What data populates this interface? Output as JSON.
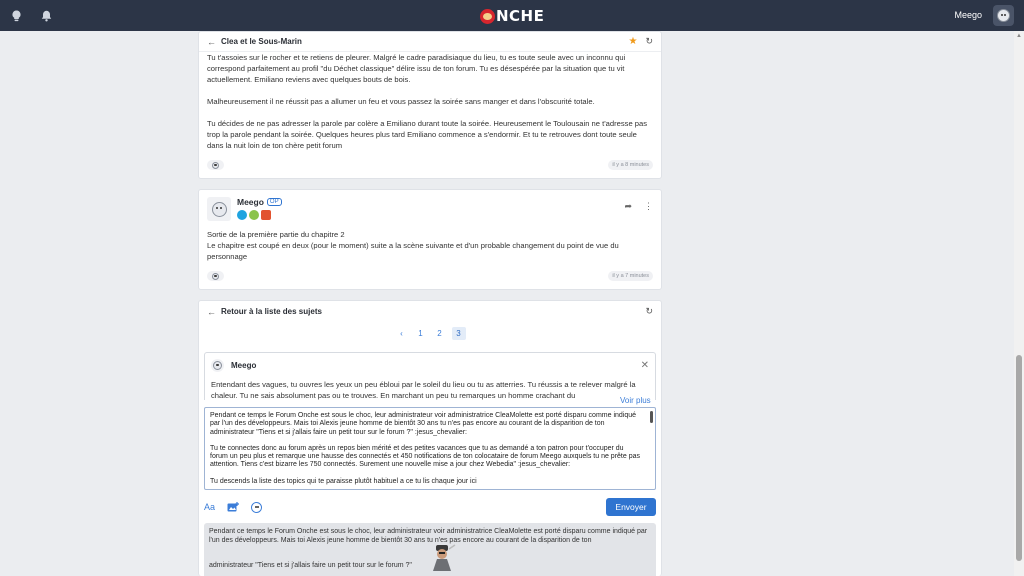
{
  "topbar": {
    "logo_text": "NCHE",
    "username": "Meego",
    "icons": [
      "lightbulb-icon",
      "bell-icon"
    ]
  },
  "topic": {
    "title": "Clea et le Sous-Marin",
    "paragraphs": [
      "Tu t'assoies sur le rocher et te retiens de pleurer. Malgré le cadre paradisiaque du lieu, tu es toute seule avec un inconnu qui correspond parfaitement au profil \"du Déchet classique\" délire issu de ton forum. Tu es désespérée par la situation que tu vit actuellement. Emiliano reviens avec quelques bouts de bois.",
      "Malheureusement il ne réussit pas a allumer un feu et vous passez la soirée sans manger et dans l'obscurité totale.",
      "Tu décides de ne pas adresser la parole par colère a Emiliano durant toute la soirée. Heureusement le Toulousain ne t'adresse pas trop la parole pendant la soirée. Quelques heures plus tard Emiliano commence a s'endormir. Et tu te retrouves dont toute seule dans la nuit loin de ton chère petit forum"
    ],
    "time": "il y a 8 minutes"
  },
  "post2": {
    "author": "Meego",
    "op_label": "OP",
    "body_lines": [
      "Sortie de la première partie du chapitre 2",
      "Le chapitre est coupé en deux (pour le moment) suite a la scène suivante et d'un probable changement du point de vue du personnage"
    ],
    "time": "il y a 7 minutes",
    "badge_colors": [
      "#1fa3e0",
      "#8bc34a",
      "#e2532f"
    ]
  },
  "reply": {
    "back_label": "Retour à la liste des sujets",
    "pages": [
      "‹",
      "1",
      "2",
      "3"
    ],
    "current_page": "3",
    "quote_author": "Meego",
    "quote_text": "Entendant des vagues, tu ouvres les yeux un peu ébloui par le soleil du lieu ou tu as atterries. Tu réussis a te relever malgré la chaleur. Tu ne sais absolument pas ou te trouves. En marchant un peu tu remarques un homme crachant du",
    "voir_plus": "Voir plus",
    "editor_paragraphs": [
      "Pendant ce temps le Forum Onche est sous le choc, leur administrateur voir administratrice CleaMolette est porté disparu comme indiqué par l'un des développeurs. Mais toi Alexis jeune homme de bientôt 30 ans tu n'es pas encore au courant de la disparition de ton administrateur \"Tiens et si j'allais faire un petit tour sur le forum ?\" :jesus_chevalier:",
      "Tu te connectes donc au forum après un repos bien mérité et des petites vacances que tu as demandé a ton patron pour t'occuper du forum un peu plus et remarque une hausse des connectés et 450 notifications de ton colocataire de forum Meego auxquels tu ne prête pas attention. Tiens c'est bizarre les 750 connectés. Surement une nouvelle mise a jour chez Webedia\" :jesus_chevalier:",
      "Tu descends la liste des topics qui te paraisse plutôt habituel a ce tu lis chaque jour ici"
    ],
    "send_label": "Envoyer",
    "font_tool_label": "Aa",
    "preview_paragraphs": [
      "Pendant ce temps le Forum Onche est sous le choc, leur administrateur voir administratrice CleaMolette est porté disparu comme indiqué par l'un des développeurs. Mais toi Alexis jeune homme de bientôt 30 ans tu n'es pas encore au courant de la disparition de ton",
      "administrateur \"Tiens et si j'allais faire un petit tour sur le forum ?\""
    ]
  }
}
